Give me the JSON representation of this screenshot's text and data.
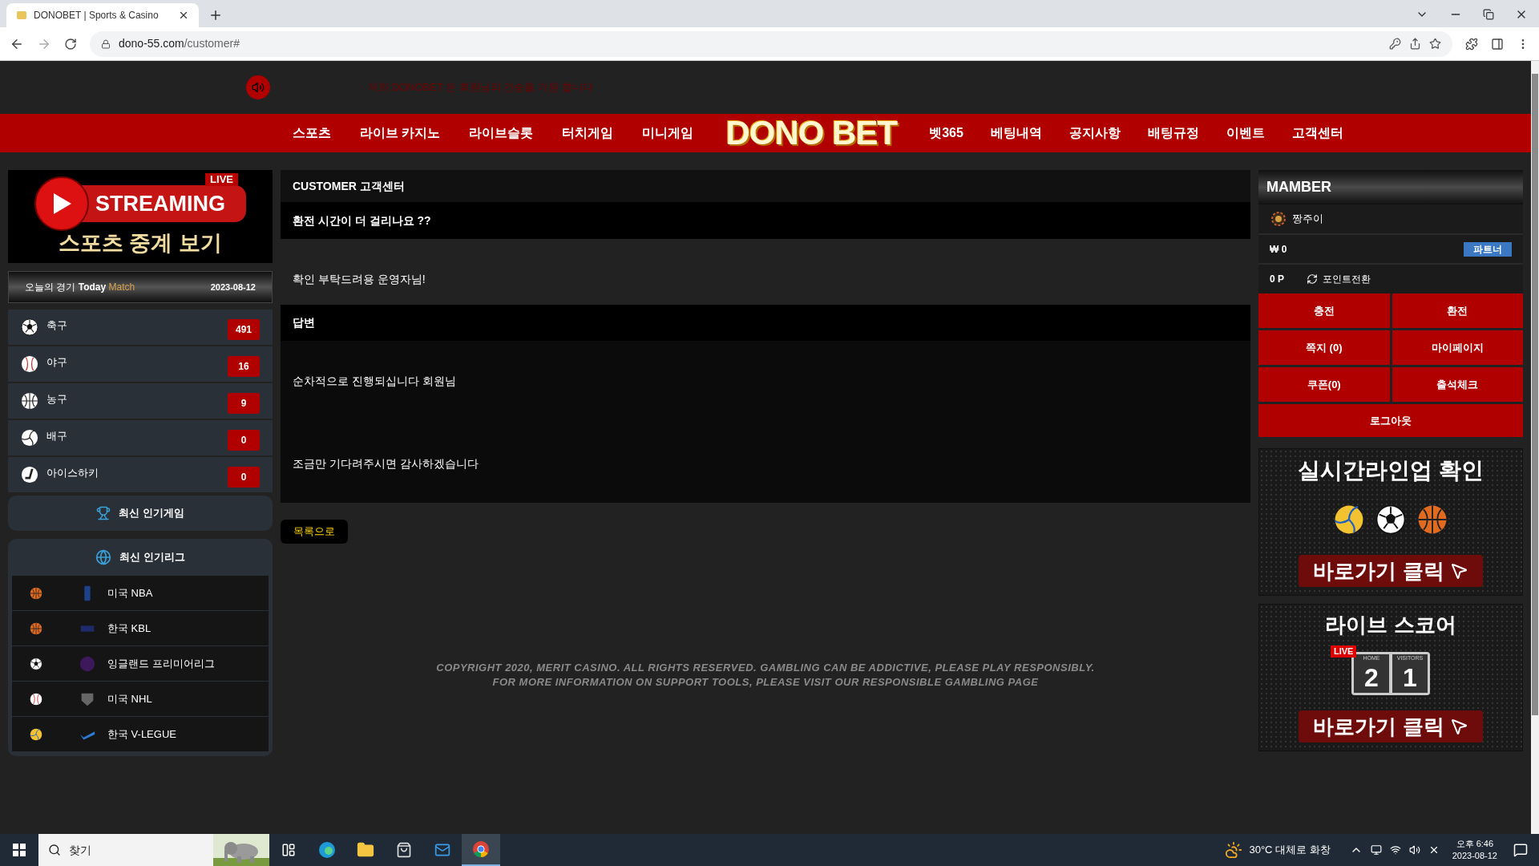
{
  "browser": {
    "tab_title": "DONOBET | Sports & Casino",
    "url_host": "dono-55.com",
    "url_path": "/customer#"
  },
  "top_bar": {
    "notice": "저희 DONOBET 은 회원님의 건승을 기원 합니다"
  },
  "nav": {
    "items_left": [
      "스포츠",
      "라이브 카지노",
      "라이브슬롯",
      "터치게임",
      "미니게임"
    ],
    "logo": "DONO BET",
    "items_right": [
      "벳365",
      "베팅내역",
      "공지사항",
      "배팅규정",
      "이벤트",
      "고객센터"
    ]
  },
  "streaming_banner": {
    "badge": "LIVE",
    "title": "STREAMING",
    "subtitle": "스포츠 중계 보기"
  },
  "today_bar": {
    "label": "오늘의 경기",
    "today": "Today",
    "match": "Match",
    "date": "2023-08-12"
  },
  "sports": [
    {
      "kind": "soccer",
      "name": "축구",
      "count": "491"
    },
    {
      "kind": "baseball",
      "name": "야구",
      "count": "16"
    },
    {
      "kind": "basketball",
      "name": "농구",
      "count": "9"
    },
    {
      "kind": "volleyball",
      "name": "배구",
      "count": "0"
    },
    {
      "kind": "hockey",
      "name": "아이스하키",
      "count": "0"
    }
  ],
  "popular_games": "최신 인기게임",
  "leagues": {
    "title": "최신 인기리그",
    "items": [
      {
        "kind": "basketball",
        "name": "미국 NBA"
      },
      {
        "kind": "basketball",
        "name": "한국 KBL"
      },
      {
        "kind": "soccer",
        "name": "잉글랜드 프리미어리그"
      },
      {
        "kind": "baseball",
        "name": "미국 NHL"
      },
      {
        "kind": "volleyball",
        "name": "한국 V-LEGUE"
      }
    ]
  },
  "content": {
    "header": "CUSTOMER 고객센터",
    "question_title": "환전 시간이 더 걸리나요 ??",
    "question_body": "확인 부탁드려용 운영자님!",
    "answer_header": "답변",
    "answer_lines": [
      "순차적으로 진행되십니다 회원님",
      "조금만 기다려주시면 감사하겠습니다"
    ],
    "back_button": "목록으로"
  },
  "footer": [
    "COPYRIGHT 2020, MERIT CASINO. ALL RIGHTS RESERVED. GAMBLING CAN BE ADDICTIVE, PLEASE PLAY RESPONSIBLY.",
    "FOR MORE INFORMATION ON SUPPORT TOOLS, PLEASE VISIT OUR RESPONSIBLE GAMBLING PAGE"
  ],
  "member": {
    "title": "MAMBER",
    "username": "짱주이",
    "balance": "₩ 0",
    "partner_button": "파트너",
    "points": "0 P",
    "convert": "포인트전환",
    "buttons": [
      "충전",
      "환전",
      "쪽지 (0)",
      "마이페이지",
      "쿠폰(0)",
      "출석체크"
    ],
    "logout": "로그아웃"
  },
  "banners": [
    {
      "kind": "lineup",
      "title": "실시간라인업 확인",
      "cta": "바로가기 클릭"
    },
    {
      "kind": "score",
      "title": "라이브 스코어",
      "live": "LIVE",
      "home": "HOME",
      "visitors": "VISITORS",
      "score_home": "2",
      "score_away": "1",
      "cta": "바로가기 클릭"
    }
  ],
  "taskbar": {
    "search_placeholder": "찾기",
    "temperature": "30°C",
    "weather": "대체로 화창",
    "time": "오후 6:46",
    "date": "2023-08-12"
  }
}
